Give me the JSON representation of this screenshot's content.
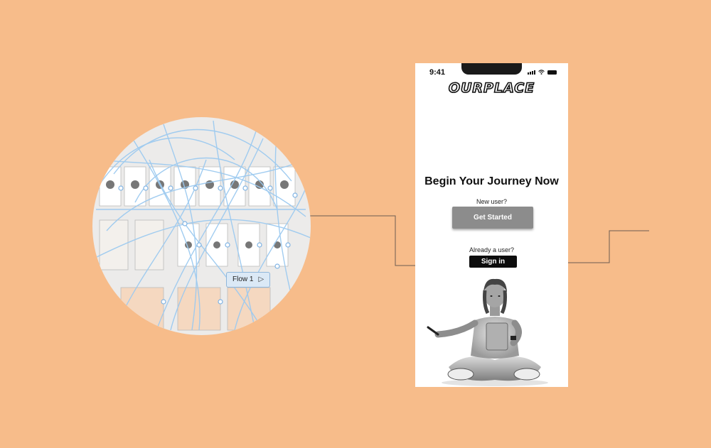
{
  "flow_thumbnail": {
    "chip_label": "Flow 1"
  },
  "phone": {
    "status_time": "9:41",
    "logo_text": "OURPLACE",
    "title": "Begin Your Journey Now",
    "new_user_label": "New user?",
    "get_started_label": "Get Started",
    "already_user_label": "Already a user?",
    "sign_in_label": "Sign in"
  },
  "colors": {
    "background": "#f7bc8a",
    "flow_lines": "#9ccaf0",
    "primary_button": "#8c8c8c",
    "secondary_button": "#0d0d0d"
  },
  "icons": [
    "signal-icon",
    "wifi-icon",
    "battery-icon",
    "play-icon"
  ]
}
